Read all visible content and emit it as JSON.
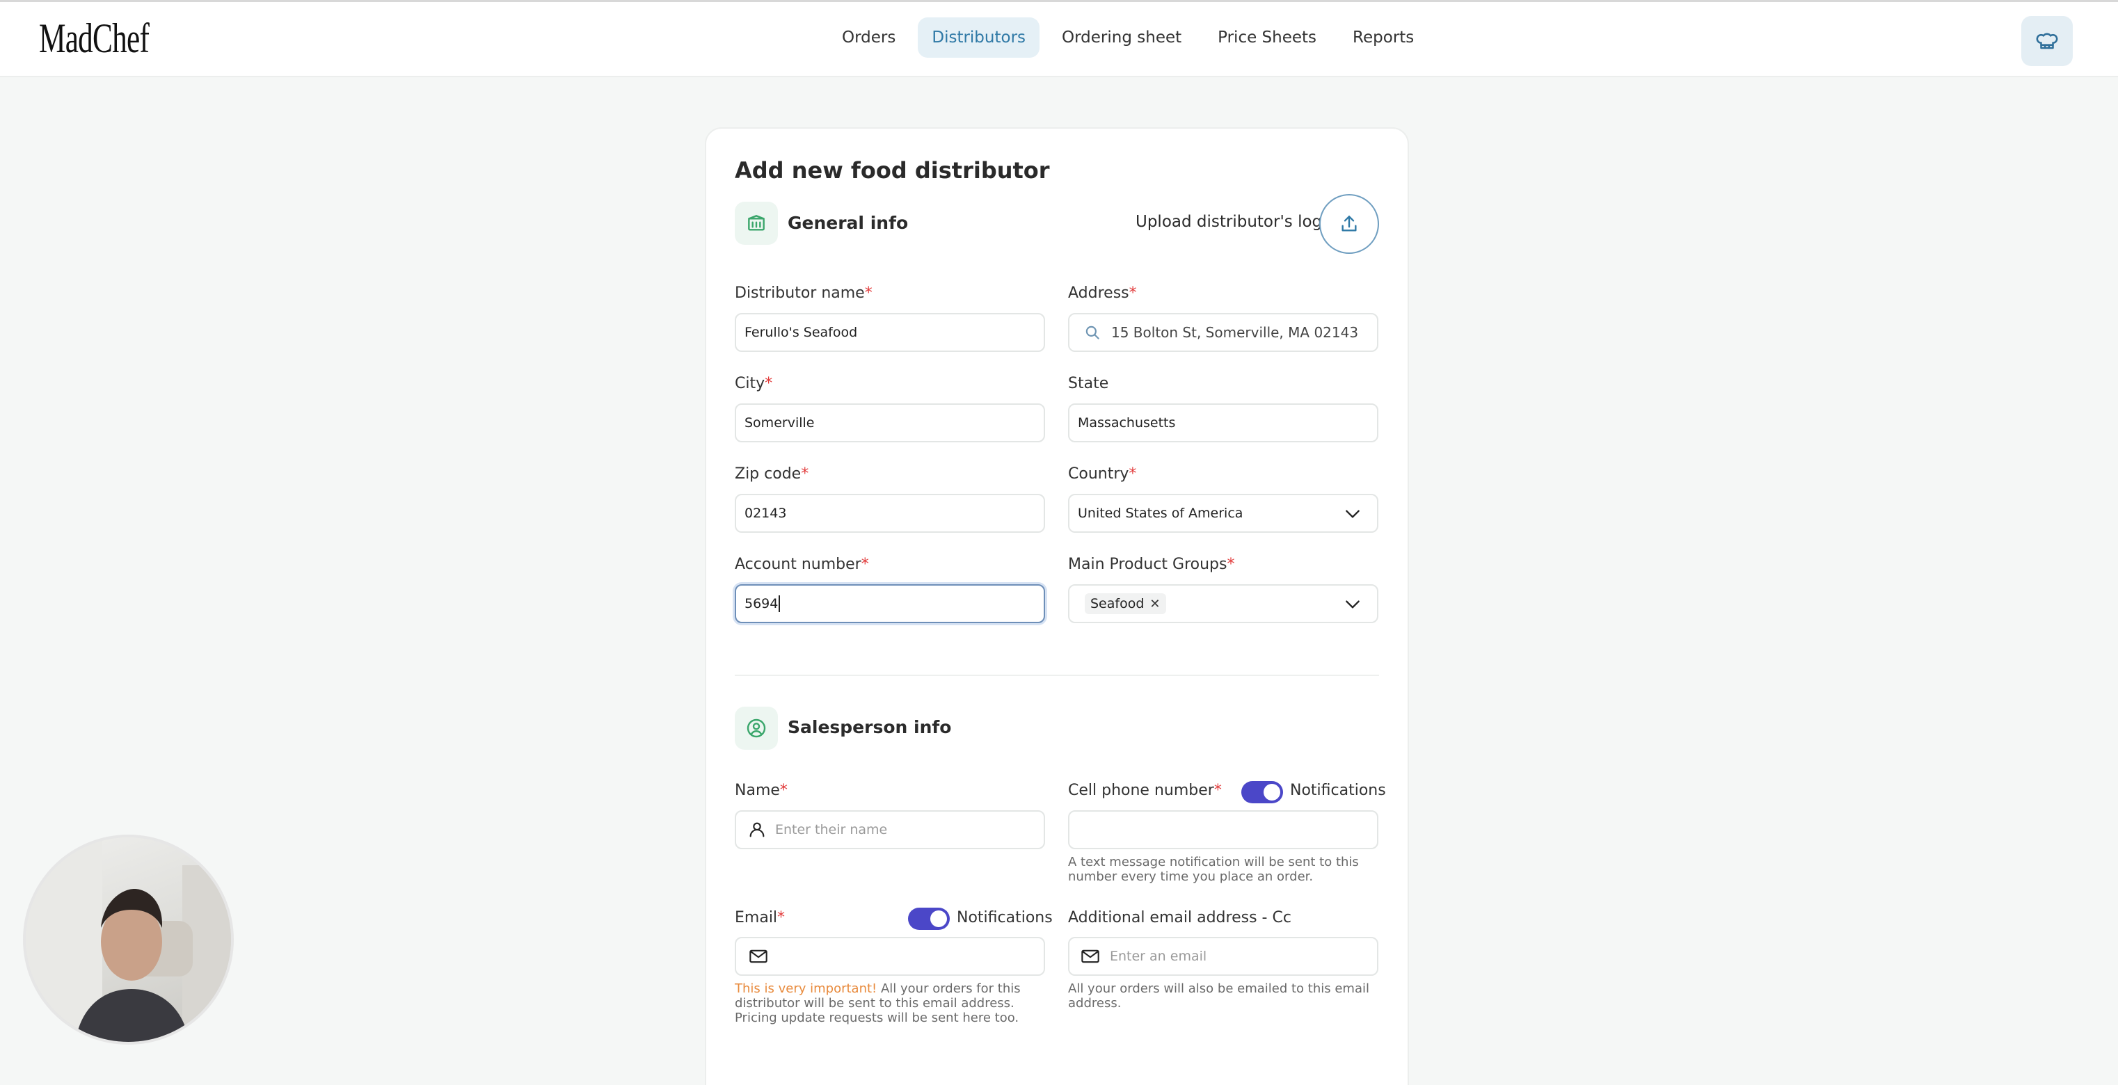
{
  "app": {
    "brand": "MadChef"
  },
  "nav": {
    "items": [
      {
        "label": "Orders"
      },
      {
        "label": "Distributors"
      },
      {
        "label": "Ordering sheet"
      },
      {
        "label": "Price Sheets"
      },
      {
        "label": "Reports"
      }
    ],
    "active": "Distributors",
    "profile_icon": "chef-hat-icon"
  },
  "form": {
    "title": "Add new food distributor",
    "general": {
      "title": "General info",
      "icon": "building-icon",
      "upload_label": "Upload distributor's logo",
      "upload_icon": "upload-icon"
    },
    "fields": {
      "distributor_name": {
        "label": "Distributor name",
        "value": "Ferullo's Seafood"
      },
      "address": {
        "label": "Address",
        "value": "15 Bolton St, Somerville, MA 02143"
      },
      "city": {
        "label": "City",
        "value": "Somerville"
      },
      "state": {
        "label": "State",
        "value": "Massachusetts"
      },
      "zip": {
        "label": "Zip code",
        "value": "02143"
      },
      "country": {
        "label": "Country",
        "value": "United States of America"
      },
      "account_number": {
        "label": "Account number",
        "value": "5694"
      },
      "product_groups": {
        "label": "Main Product Groups",
        "tags": [
          "Seafood"
        ]
      }
    },
    "salesperson": {
      "title": "Salesperson info",
      "icon": "user-circle-icon",
      "name": {
        "label": "Name",
        "placeholder": "Enter their name"
      },
      "phone": {
        "label": "Cell phone number",
        "notifications_label": "Notifications",
        "notifications_on": true,
        "help": "A text message notification will be sent to this number every time you place an order."
      },
      "email": {
        "label": "Email",
        "notifications_label": "Notifications",
        "notifications_on": true,
        "help_warn": "This is very important!",
        "help": " All your orders for this distributor will be sent to this email address. Pricing update requests will be sent here too."
      },
      "cc_email": {
        "label": "Additional email address - Cc",
        "placeholder": "Enter an email",
        "help": "All your orders will also be emailed to this email address."
      }
    }
  },
  "colors": {
    "accent": "#4b47c8",
    "active_nav_bg": "#e5f0f6",
    "active_nav_text": "#2f79a6",
    "section_icon": "#3aa66b",
    "required": "#e23b3b"
  }
}
